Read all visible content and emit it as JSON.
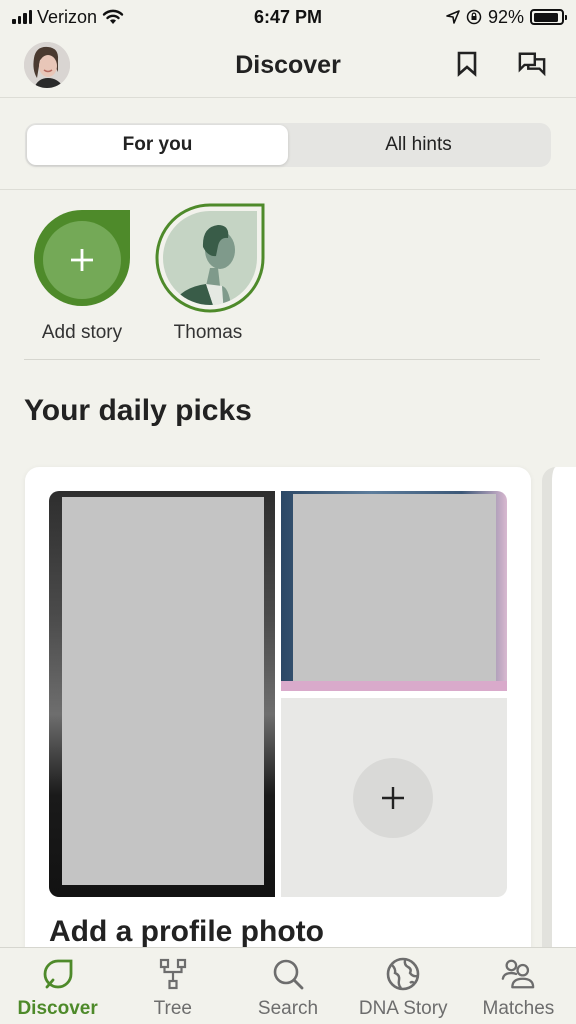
{
  "status_bar": {
    "carrier": "Verizon",
    "time": "6:47 PM",
    "battery_percent": "92%",
    "battery_level": 0.92
  },
  "header": {
    "title": "Discover",
    "icons": [
      "bookmark-icon",
      "messages-icon"
    ]
  },
  "segmented": {
    "tabs": [
      {
        "label": "For you",
        "active": true
      },
      {
        "label": "All hints",
        "active": false
      }
    ]
  },
  "stories": [
    {
      "label": "Add story",
      "type": "add"
    },
    {
      "label": "Thomas",
      "type": "person"
    }
  ],
  "daily_picks": {
    "title": "Your daily picks",
    "card": {
      "title": "Add a profile photo"
    }
  },
  "tabbar": {
    "items": [
      {
        "label": "Discover",
        "icon": "leaf-icon",
        "active": true
      },
      {
        "label": "Tree",
        "icon": "tree-icon",
        "active": false
      },
      {
        "label": "Search",
        "icon": "search-icon",
        "active": false
      },
      {
        "label": "DNA Story",
        "icon": "globe-icon",
        "active": false
      },
      {
        "label": "Matches",
        "icon": "people-icon",
        "active": false
      }
    ]
  },
  "colors": {
    "accent": "#4e8a2a",
    "accent_light": "#74a957",
    "background": "#f2f2ec"
  }
}
